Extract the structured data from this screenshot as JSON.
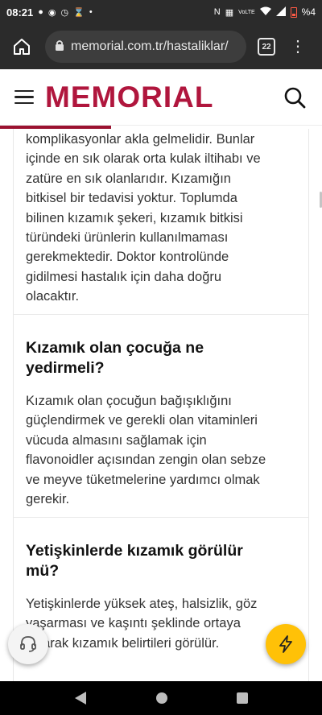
{
  "status_bar": {
    "time": "08:21",
    "battery_percent": "%4",
    "network_label": "VoLTE",
    "left_icons": [
      "message-icon",
      "facebook-icon",
      "alarm-icon",
      "hourglass-icon",
      "dot-icon"
    ],
    "right_icons": [
      "nfc-icon",
      "vibrate-icon",
      "volte-icon",
      "wifi-icon",
      "signal-icon",
      "battery-low-icon"
    ]
  },
  "browser": {
    "url": "memorial.com.tr/hastaliklar/",
    "tab_count": "22"
  },
  "site": {
    "logo_text": "MEMORIAL",
    "brand_color": "#b0163d"
  },
  "article": {
    "blocks": [
      {
        "type": "paragraph",
        "lines": [
          "komplikasyonlar akla gelmelidir. Bunlar",
          "içinde en sık olarak orta kulak iltihabı ve",
          "zatüre en sık olanlarıdır. Kızamığın",
          "bitkisel bir tedavisi yoktur. Toplumda",
          "bilinen kızamık şekeri, kızamık bitkisi",
          "türündeki ürünlerin kullanılmaması",
          "gerekmektedir. Doktor kontrolünde",
          "gidilmesi hastalık için daha doğru",
          "olacaktır."
        ]
      },
      {
        "type": "heading",
        "lines": [
          "Kızamık olan çocuğa ne",
          "yedirmeli?"
        ]
      },
      {
        "type": "paragraph",
        "lines": [
          "Kızamık olan çocuğun bağışıklığını",
          "güçlendirmek ve gerekli olan vitaminleri",
          "vücuda almasını sağlamak için",
          "flavonoidler açısından zengin olan sebze",
          "ve meyve tüketmelerine yardımcı olmak",
          "gerekir."
        ]
      },
      {
        "type": "heading",
        "lines": [
          "Yetişkinlerde kızamık görülür",
          "mü?"
        ]
      },
      {
        "type": "paragraph",
        "lines": [
          "Yetişkinlerde yüksek ateş, halsizlik, göz",
          "yaşarması ve kaşıntı şeklinde ortaya",
          "çıkarak kızamık belirtileri görülür."
        ]
      }
    ]
  },
  "colors": {
    "accent_fab": "#ffc107",
    "progress": "#9b1230"
  }
}
